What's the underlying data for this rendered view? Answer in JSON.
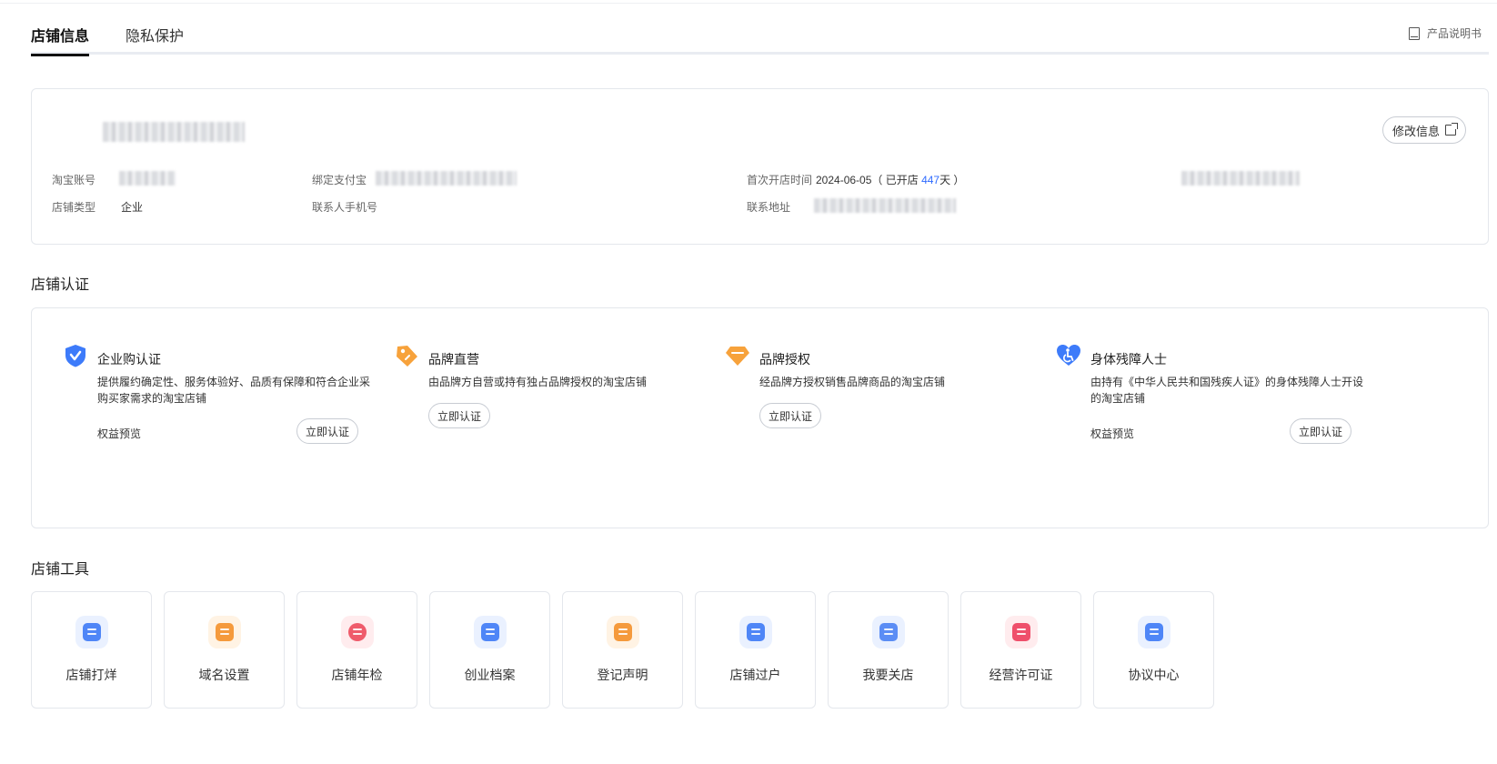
{
  "tabs": {
    "info": "店铺信息",
    "privacy": "隐私保护",
    "manual": "产品说明书"
  },
  "info_card": {
    "edit_button": "修改信息",
    "taobao_account_label": "淘宝账号",
    "alipay_label": "绑定支付宝",
    "open_time_label": "首次开店时间",
    "open_date": "2024-06-05",
    "open_days_prefix": "（ 已开店 ",
    "open_days": "447",
    "open_days_suffix": "天 ）",
    "shop_type_label": "店铺类型",
    "shop_type_value": "企业",
    "phone_label": "联系人手机号",
    "address_label": "联系地址"
  },
  "certification": {
    "title": "店铺认证",
    "items": [
      {
        "title": "企业购认证",
        "desc": "提供履约确定性、服务体验好、品质有保障和符合企业采购买家需求的淘宝店铺",
        "benefit": "权益预览",
        "button": "立即认证",
        "icon": "shield-check-icon",
        "color": "#3d7bfa"
      },
      {
        "title": "品牌直营",
        "desc": "由品牌方自营或持有独占品牌授权的淘宝店铺",
        "benefit": "",
        "button": "立即认证",
        "icon": "tag-icon",
        "color": "#f7a23b"
      },
      {
        "title": "品牌授权",
        "desc": "经品牌方授权销售品牌商品的淘宝店铺",
        "benefit": "",
        "button": "立即认证",
        "icon": "diamond-icon",
        "color": "#f7a23b"
      },
      {
        "title": "身体残障人士",
        "desc": "由持有《中华人民共和国残疾人证》的身体残障人士开设的淘宝店铺",
        "benefit": "权益预览",
        "button": "立即认证",
        "icon": "accessibility-heart-icon",
        "color": "#3d7bfa"
      }
    ]
  },
  "tools": {
    "title": "店铺工具",
    "items": [
      {
        "label": "店铺打烊",
        "icon": "shop-close-icon",
        "color": "#4f86f7",
        "bg": "#eaf1ff"
      },
      {
        "label": "域名设置",
        "icon": "domain-icon",
        "color": "#f59a3c",
        "bg": "#fff3e4"
      },
      {
        "label": "店铺年检",
        "icon": "shield-search-icon",
        "color": "#ef5b6b",
        "bg": "#ffecee"
      },
      {
        "label": "创业档案",
        "icon": "archive-icon",
        "color": "#4f86f7",
        "bg": "#eaf1ff"
      },
      {
        "label": "登记声明",
        "icon": "statement-icon",
        "color": "#f59a3c",
        "bg": "#fff3e4"
      },
      {
        "label": "店铺过户",
        "icon": "transfer-icon",
        "color": "#4f86f7",
        "bg": "#eaf1ff"
      },
      {
        "label": "我要关店",
        "icon": "close-shop-icon",
        "color": "#5b8df5",
        "bg": "#eaf1ff"
      },
      {
        "label": "经营许可证",
        "icon": "license-icon",
        "color": "#ef4f6b",
        "bg": "#ffecee"
      },
      {
        "label": "协议中心",
        "icon": "agreement-icon",
        "color": "#4f86f7",
        "bg": "#eaf1ff"
      }
    ]
  }
}
